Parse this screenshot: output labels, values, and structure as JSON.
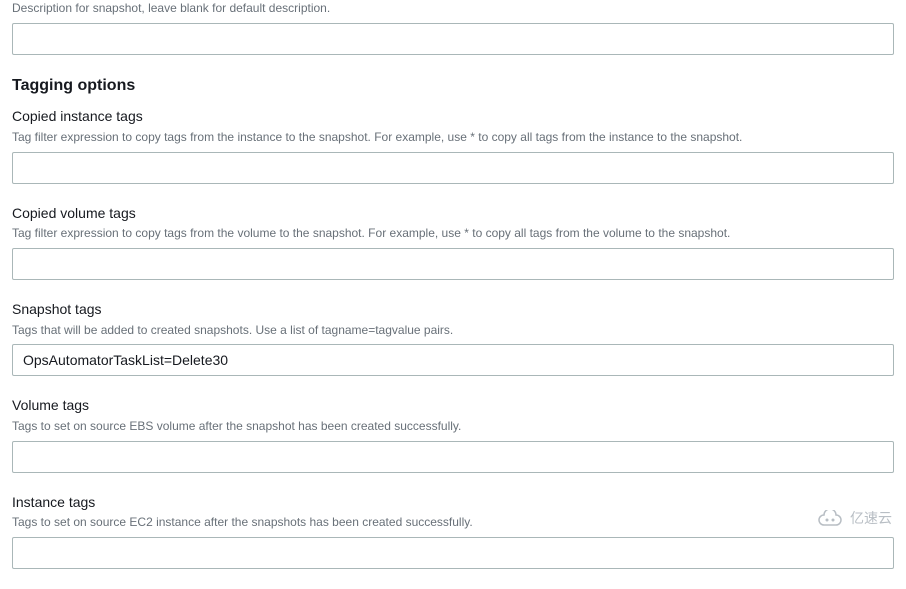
{
  "description": {
    "help": "Description for snapshot, leave blank for default description.",
    "value": ""
  },
  "tagging": {
    "heading": "Tagging options",
    "copiedInstanceTags": {
      "label": "Copied instance tags",
      "help": "Tag filter expression to copy tags from the instance to the snapshot. For example, use * to copy all tags from the instance to the snapshot.",
      "value": ""
    },
    "copiedVolumeTags": {
      "label": "Copied volume tags",
      "help": "Tag filter expression to copy tags from the volume to the snapshot. For example, use * to copy all tags from the volume to the snapshot.",
      "value": ""
    },
    "snapshotTags": {
      "label": "Snapshot tags",
      "help": "Tags that will be added to created snapshots. Use a list of tagname=tagvalue pairs.",
      "value": "OpsAutomatorTaskList=Delete30"
    },
    "volumeTags": {
      "label": "Volume tags",
      "help": "Tags to set on source EBS volume after the snapshot has been created successfully.",
      "value": ""
    },
    "instanceTags": {
      "label": "Instance tags",
      "help": "Tags to set on source EC2 instance after the snapshots has been created successfully.",
      "value": ""
    }
  },
  "watermark": {
    "text": "亿速云"
  }
}
